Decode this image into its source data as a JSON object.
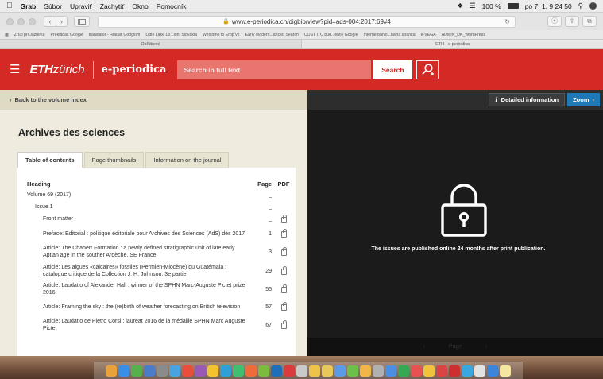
{
  "menubar": {
    "apple": "",
    "items": [
      "Grab",
      "Súbor",
      "Upraviť",
      "Zachytiť",
      "Okno",
      "Pomocník"
    ],
    "status": {
      "battery": "100 %",
      "clock": "po 7. 1.  9 24 50"
    }
  },
  "browser": {
    "url": "www.e-periodica.ch/digbib/view?pid=ads-004:2017:69#4",
    "bookmarks": [
      "Zrub pri Jazierku",
      "Prekladač Google",
      "translator - Hľadať Googlom",
      "Little Lake Lo...ion, Slovakia",
      "Welcome to Erpp v2",
      "Early Modern...anced Search",
      "COST ITC bud...ently Google",
      "Internetbanki...lavná stránka",
      "e-VEGA",
      "ADMIN_DK_WordPress"
    ],
    "tabs": [
      "Obľúbené",
      "ETH - e-periodica"
    ]
  },
  "header": {
    "eth": "ETH",
    "zurich": "zürich",
    "brand": "e-periodica",
    "search_placeholder": "Search in full text",
    "search_button": "Search"
  },
  "left": {
    "back": "Back to the volume index",
    "title": "Archives des sciences",
    "tabs": [
      "Table of contents",
      "Page thumbnails",
      "Information on the journal"
    ],
    "toc_header": {
      "heading": "Heading",
      "page": "Page",
      "pdf": "PDF"
    },
    "rows": [
      {
        "indent": 0,
        "title": "Volume 69 (2017)",
        "page": "_",
        "pdf": false
      },
      {
        "indent": 1,
        "title": "Issue 1",
        "page": "_",
        "pdf": false
      },
      {
        "indent": 2,
        "title": "Front matter",
        "page": "_",
        "pdf": true
      },
      {
        "indent": 2,
        "title": "Preface: Editorial : politique éditoriale pour Archives des Sciences (AdS) dès 2017",
        "page": "1",
        "pdf": true
      },
      {
        "indent": 2,
        "title": "Article: The Chabert Formation : a newly defined stratigraphic unit of late early Aptian age in the souther Ardèche, SE France",
        "page": "3",
        "pdf": true
      },
      {
        "indent": 2,
        "title": "Article: Les algues «calcaires» fossiles (Permien-Miocène) du Guatémala : catalogue critique de la Collection J. H. Johnson. 3e partie",
        "page": "29",
        "pdf": true
      },
      {
        "indent": 2,
        "title": "Article: Laudatio of Alexander Hall : winner of the SPHN Marc-Auguste Pictet prize 2016",
        "page": "55",
        "pdf": true
      },
      {
        "indent": 2,
        "title": "Article: Framing the sky : the (re)birth of weather forecasting on British television",
        "page": "57",
        "pdf": true
      },
      {
        "indent": 2,
        "title": "Article: Laudatio de Pietro Corsi : lauréat 2016 de la médaille SPHN Marc Auguste Pictet",
        "page": "67",
        "pdf": true
      }
    ]
  },
  "right": {
    "detail_icon": "i",
    "detail": "Detailed information",
    "zoom": "Zoom",
    "message": "The issues are published online 24 months after print publication.",
    "page_label": "Page"
  },
  "dock": {
    "colors": [
      "#e9a23b",
      "#3a8ee6",
      "#56b04c",
      "#4b7cc9",
      "#8b8b8b",
      "#4aa3df",
      "#e94e3c",
      "#9b59b6",
      "#f2c230",
      "#2fa0d6",
      "#3fbf6f",
      "#f06b3a",
      "#7dbb3e",
      "#1f6fb8",
      "#d93c3c",
      "#c9c9c9",
      "#eec34a",
      "#e8c85a",
      "#5b9be6",
      "#6cc04a",
      "#f0b64a",
      "#b0b0b0",
      "#4c8fe0",
      "#35a853",
      "#e65252",
      "#f1c23b",
      "#d94545",
      "#cc2f2f",
      "#3aa7e0",
      "#e2e2e2",
      "#3d85d8",
      "#f4e8a0"
    ]
  }
}
